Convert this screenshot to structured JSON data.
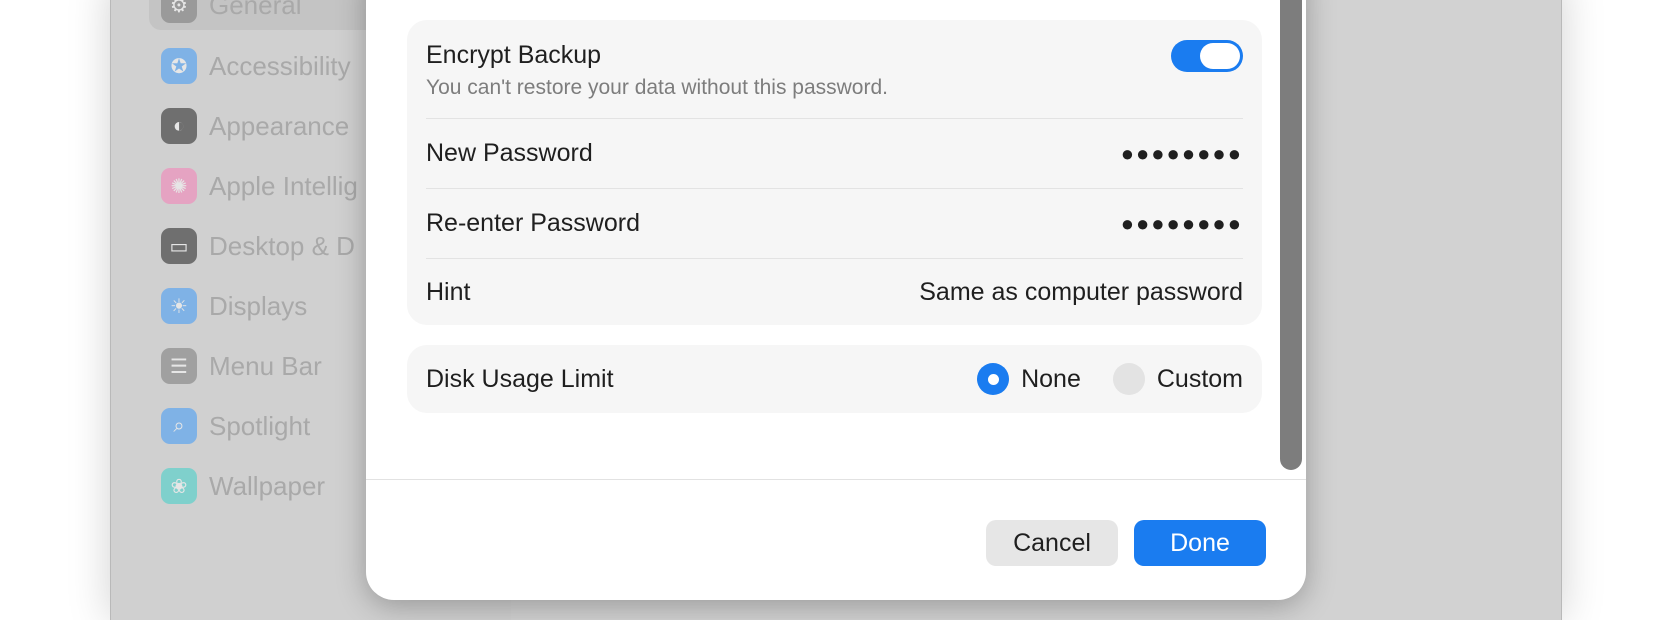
{
  "sidebar": {
    "items": [
      {
        "label": "General",
        "icon": "gear-icon",
        "color": "#9a9a9a"
      },
      {
        "label": "Accessibility",
        "icon": "accessibility-icon",
        "color": "#7fb2e6"
      },
      {
        "label": "Appearance",
        "icon": "appearance-icon",
        "color": "#6f6f6f"
      },
      {
        "label": "Apple Intellig",
        "icon": "apple-intelligence-icon",
        "color": "#e5a3c2"
      },
      {
        "label": "Desktop & D",
        "icon": "desktop-dock-icon",
        "color": "#6f6f6f"
      },
      {
        "label": "Displays",
        "icon": "sun-icon",
        "color": "#7fb2e6"
      },
      {
        "label": "Menu Bar",
        "icon": "menu-bar-icon",
        "color": "#a0a0a0"
      },
      {
        "label": "Spotlight",
        "icon": "magnifier-icon",
        "color": "#7fb2e6"
      },
      {
        "label": "Wallpaper",
        "icon": "flower-icon",
        "color": "#7fd0cc"
      }
    ]
  },
  "encrypt": {
    "label": "Encrypt Backup",
    "subtitle": "You can't restore your data without this password.",
    "enabled": true
  },
  "new_password": {
    "label": "New Password",
    "value": "●●●●●●●●"
  },
  "reenter_password": {
    "label": "Re-enter Password",
    "value": "●●●●●●●●"
  },
  "hint": {
    "label": "Hint",
    "value": "Same as computer password"
  },
  "disk_usage": {
    "label": "Disk Usage Limit",
    "options": [
      {
        "label": "None",
        "selected": true
      },
      {
        "label": "Custom",
        "selected": false
      }
    ]
  },
  "buttons": {
    "cancel": "Cancel",
    "done": "Done"
  },
  "colors": {
    "accent": "#1a7cf0"
  }
}
